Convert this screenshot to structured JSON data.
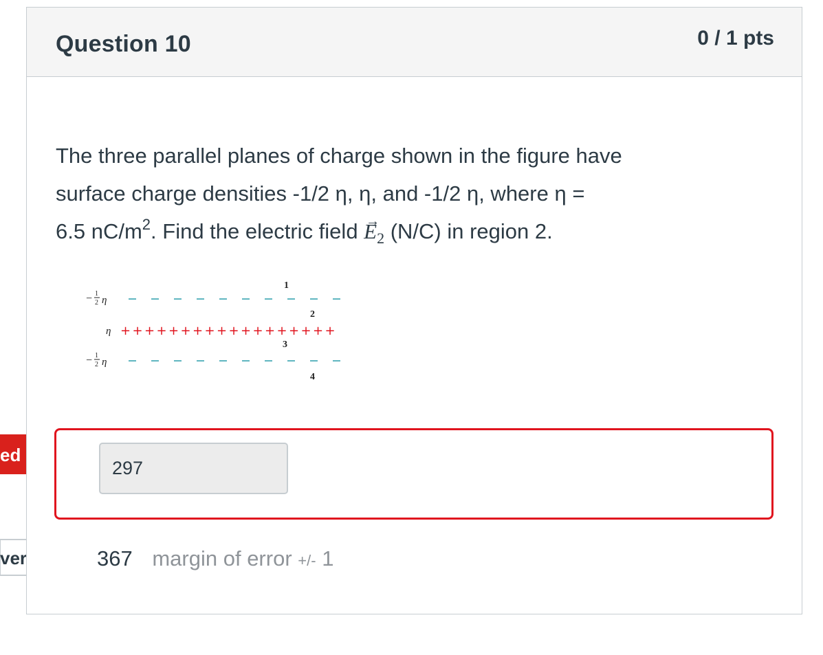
{
  "question": {
    "title": "Question 10",
    "points": "0 / 1 pts",
    "text_line1": "The three parallel planes of charge shown in the figure have",
    "text_line2": "surface charge densities -1/2 η, η, and -1/2 η, where η =",
    "text_line3_a": "6.5 nC/m",
    "text_line3_sup": "2",
    "text_line3_b": ". Find the electric field ",
    "field_symbol": "E",
    "field_subscript": "2",
    "text_line3_c": " (N/C) in region 2."
  },
  "figure": {
    "plane_top_label_prefix": "−",
    "plane_top_label_num": "1",
    "plane_top_label_den": "2",
    "plane_top_label_sym": "η",
    "plane_mid_label": "η",
    "plane_bot_label_prefix": "−",
    "plane_bot_label_num": "1",
    "plane_bot_label_den": "2",
    "plane_bot_label_sym": "η",
    "region_1": "1",
    "region_2": "2",
    "region_3": "3",
    "region_4": "4",
    "negative_color": "#5fb6c0",
    "positive_color": "#e0141e"
  },
  "answer": {
    "user_value": "297",
    "border_color": "#e0141e"
  },
  "correct": {
    "value": "367",
    "margin_label": "margin of error",
    "plus_minus": "+/-",
    "tolerance": "1"
  },
  "flags": {
    "incorrect_text": "ed",
    "incorrect_color": "#d9211c",
    "answer_text": "ver"
  }
}
